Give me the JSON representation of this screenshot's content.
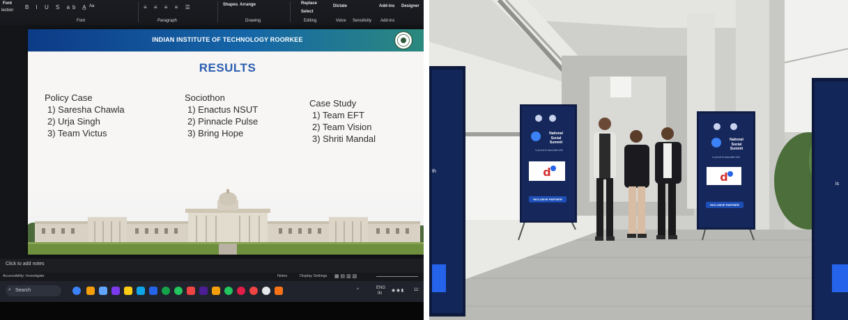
{
  "screen": {
    "ribbon": {
      "groups": [
        "Font",
        "Paragraph",
        "Drawing",
        "Editing",
        "Voice",
        "Sensitivity",
        "Add-ins"
      ],
      "commands": [
        "Shapes",
        "Arrange",
        "Replace",
        "Select",
        "Dictate",
        "Add-ins",
        "Designer"
      ],
      "left_fragments": [
        "Font",
        "lection"
      ],
      "font_size_label": "Aa"
    },
    "slide": {
      "banner": "INDIAN INSTITUTE OF TECHNOLOGY ROORKEE",
      "title": "RESULTS",
      "columns": [
        {
          "heading": "Policy Case",
          "items": [
            "1)  Saresha Chawla",
            "2)  Urja Singh",
            "3)  Team Victus"
          ]
        },
        {
          "heading": "Sociothon",
          "items": [
            "1)  Enactus NSUT",
            "2)  Pinnacle Pulse",
            "3)  Bring Hope"
          ]
        },
        {
          "heading": "Case Study",
          "items": [
            "1) Team EFT",
            "2)  Team Vision",
            "3)  Shriti Mandal"
          ]
        }
      ]
    },
    "notes_placeholder": "Click to add notes",
    "status": {
      "accessibility": "Accessibility: Investigate",
      "notes": "Notes",
      "display_settings": "Display Settings"
    },
    "taskbar": {
      "search": "Search",
      "lang_top": "ENG",
      "lang_bottom": "IN",
      "clock": "11:"
    }
  },
  "standees": {
    "title_lines": [
      "National",
      "Social",
      "Summit"
    ],
    "tagline": "is proud to associate with",
    "partner_label": "INCLUSIVE PARTNER",
    "edge_fragment_left": "th",
    "edge_fragment_right": "is"
  }
}
